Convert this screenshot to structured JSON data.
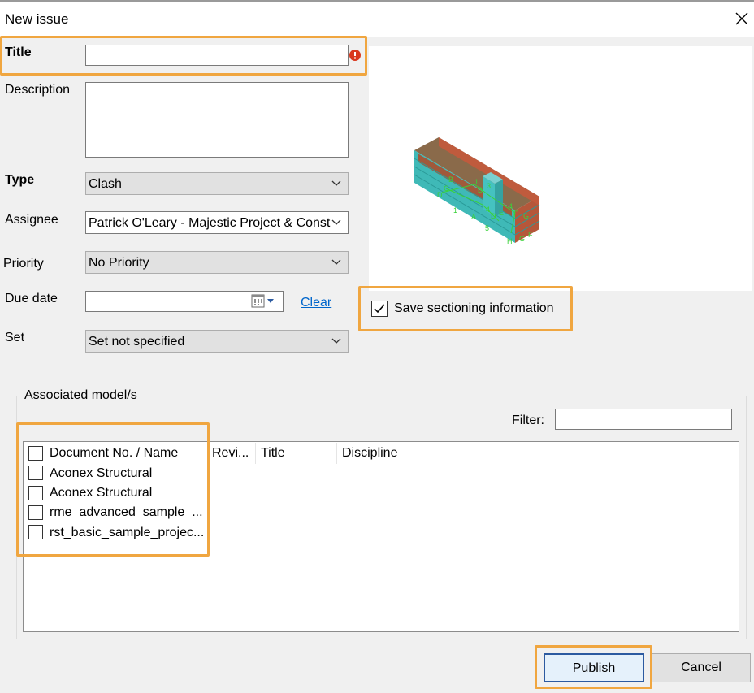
{
  "window": {
    "title": "New issue"
  },
  "form": {
    "title_label": "Title",
    "title_value": "",
    "description_label": "Description",
    "description_value": "",
    "type_label": "Type",
    "type_value": "Clash",
    "assignee_label": "Assignee",
    "assignee_value": "Patrick O'Leary - Majestic Project & Const",
    "priority_label": "Priority",
    "priority_value": "No Priority",
    "due_date_label": "Due date",
    "due_date_value": "",
    "clear_label": "Clear",
    "set_label": "Set",
    "set_value": "Set not specified"
  },
  "sectioning": {
    "label": "Save sectioning information",
    "checked": true
  },
  "models": {
    "group_label": "Associated model/s",
    "filter_label": "Filter:",
    "filter_value": "",
    "columns": [
      "Document No. / Name",
      "Revi...",
      "Title",
      "Discipline"
    ],
    "rows": [
      {
        "name": "Aconex Structural"
      },
      {
        "name": "Aconex Structural"
      },
      {
        "name": "rme_advanced_sample_..."
      },
      {
        "name": "rst_basic_sample_projec..."
      }
    ]
  },
  "buttons": {
    "publish": "Publish",
    "cancel": "Cancel"
  },
  "colors": {
    "highlight": "#f0a640",
    "link": "#0066cc",
    "error": "#d9381e"
  }
}
